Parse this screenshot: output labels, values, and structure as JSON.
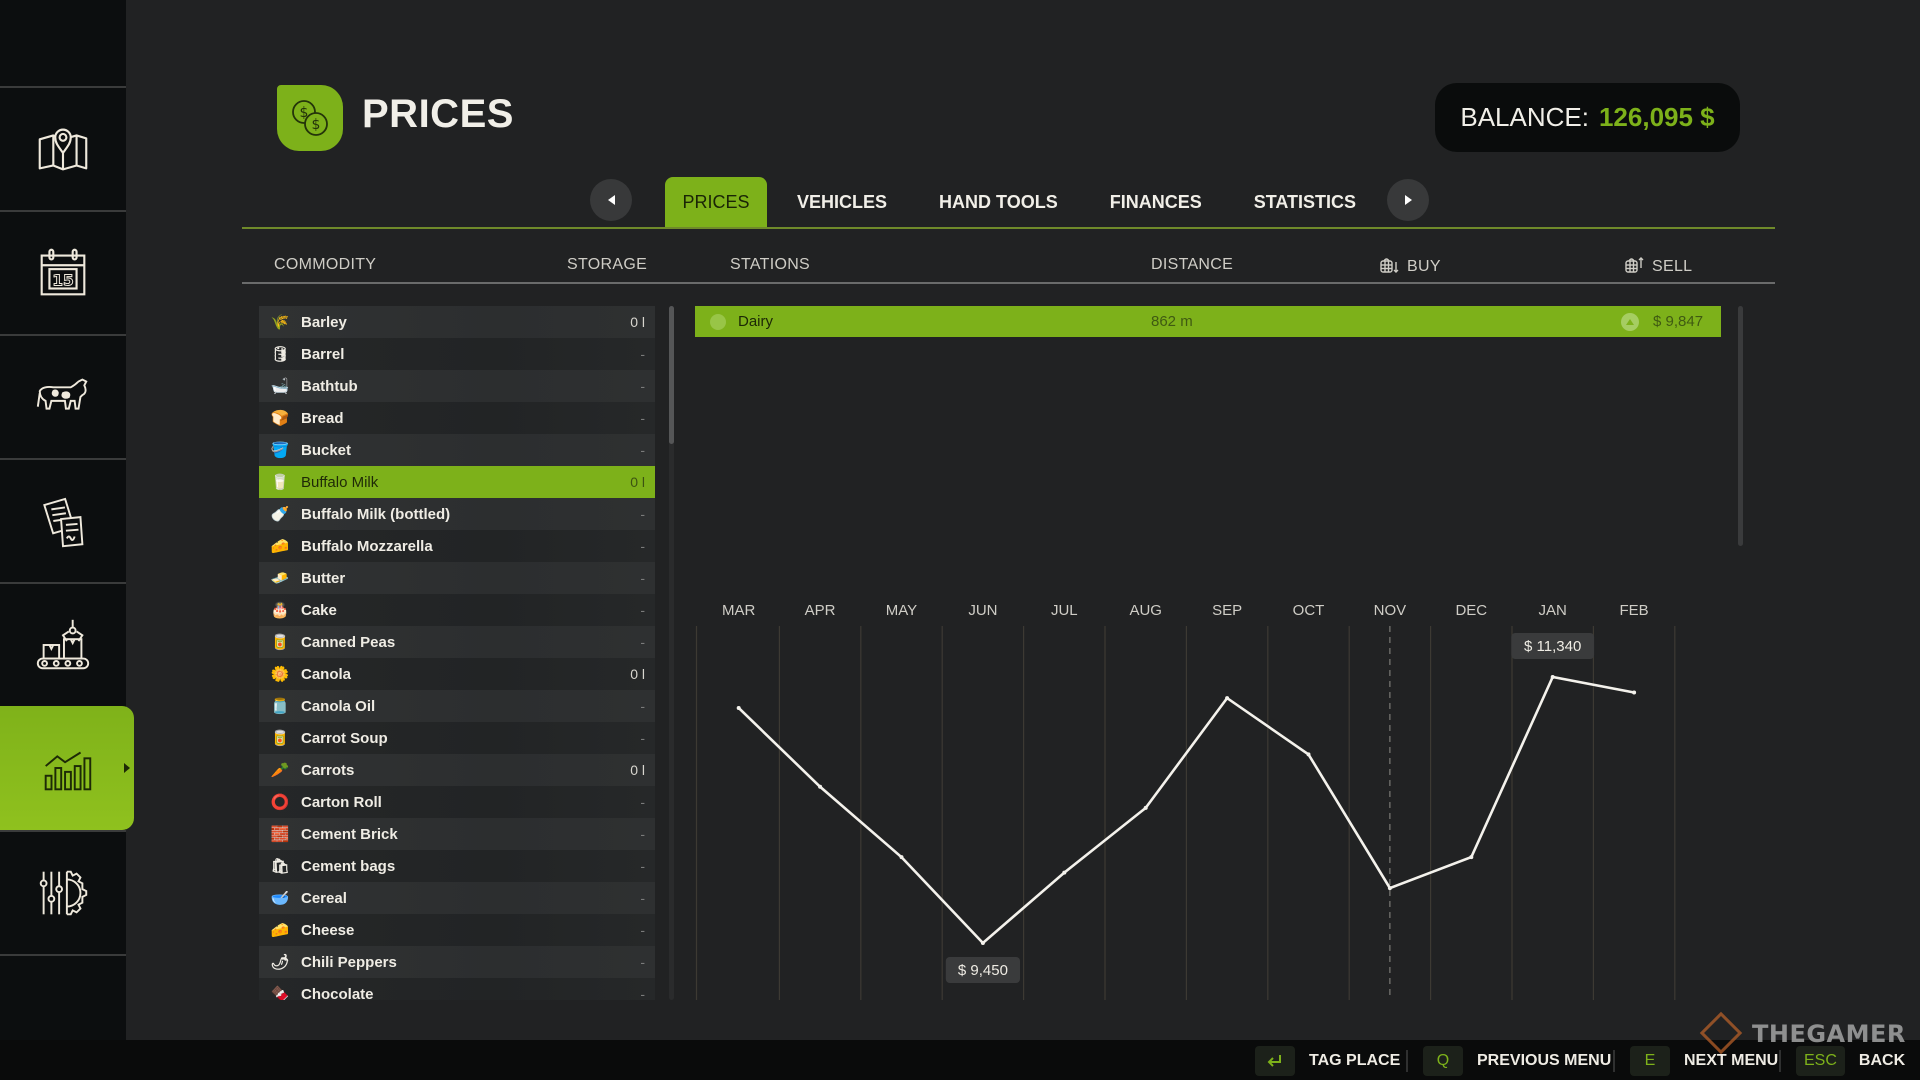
{
  "sidebar": {
    "items": [
      {
        "name": "map",
        "icon": "map-pin-icon",
        "active": false
      },
      {
        "name": "calendar",
        "icon": "calendar-icon",
        "active": false,
        "day": "15"
      },
      {
        "name": "animals",
        "icon": "cow-icon",
        "active": false
      },
      {
        "name": "contracts",
        "icon": "documents-icon",
        "active": false
      },
      {
        "name": "production",
        "icon": "production-icon",
        "active": false
      },
      {
        "name": "prices",
        "icon": "chart-icon",
        "active": true
      },
      {
        "name": "settings",
        "icon": "settings-icon",
        "active": false
      }
    ]
  },
  "header": {
    "title": "PRICES",
    "icon": "coins-icon",
    "balance_label": "BALANCE:",
    "balance_value": "126,095 $"
  },
  "tabs": [
    {
      "label": "PRICES",
      "active": true
    },
    {
      "label": "VEHICLES",
      "active": false
    },
    {
      "label": "HAND TOOLS",
      "active": false
    },
    {
      "label": "FINANCES",
      "active": false
    },
    {
      "label": "STATISTICS",
      "active": false
    }
  ],
  "columns": {
    "commodity": "COMMODITY",
    "storage": "STORAGE",
    "stations": "STATIONS",
    "distance": "DISTANCE",
    "buy": "BUY",
    "sell": "SELL"
  },
  "commodities": [
    {
      "name": "Barley",
      "storage": "0 l",
      "icon": "🌾"
    },
    {
      "name": "Barrel",
      "storage": "-",
      "icon": "🛢"
    },
    {
      "name": "Bathtub",
      "storage": "-",
      "icon": "🛁"
    },
    {
      "name": "Bread",
      "storage": "-",
      "icon": "🍞"
    },
    {
      "name": "Bucket",
      "storage": "-",
      "icon": "🪣"
    },
    {
      "name": "Buffalo Milk",
      "storage": "0 l",
      "icon": "🥛",
      "selected": true
    },
    {
      "name": "Buffalo Milk (bottled)",
      "storage": "-",
      "icon": "🍼"
    },
    {
      "name": "Buffalo Mozzarella",
      "storage": "-",
      "icon": "🧀"
    },
    {
      "name": "Butter",
      "storage": "-",
      "icon": "🧈"
    },
    {
      "name": "Cake",
      "storage": "-",
      "icon": "🎂"
    },
    {
      "name": "Canned Peas",
      "storage": "-",
      "icon": "🥫"
    },
    {
      "name": "Canola",
      "storage": "0 l",
      "icon": "🌼"
    },
    {
      "name": "Canola Oil",
      "storage": "-",
      "icon": "🫙"
    },
    {
      "name": "Carrot Soup",
      "storage": "-",
      "icon": "🥫"
    },
    {
      "name": "Carrots",
      "storage": "0 l",
      "icon": "🥕"
    },
    {
      "name": "Carton Roll",
      "storage": "-",
      "icon": "⭕"
    },
    {
      "name": "Cement Brick",
      "storage": "-",
      "icon": "🧱"
    },
    {
      "name": "Cement bags",
      "storage": "-",
      "icon": "🛍"
    },
    {
      "name": "Cereal",
      "storage": "-",
      "icon": "🥣"
    },
    {
      "name": "Cheese",
      "storage": "-",
      "icon": "🧀"
    },
    {
      "name": "Chili Peppers",
      "storage": "-",
      "icon": "🌶"
    },
    {
      "name": "Chocolate",
      "storage": "-",
      "icon": "🍫"
    }
  ],
  "stations": [
    {
      "name": "Dairy",
      "distance": "862 m",
      "sell_price": "$ 9,847",
      "trend": "up"
    }
  ],
  "chart_data": {
    "type": "line",
    "title": "",
    "categories": [
      "MAR",
      "APR",
      "MAY",
      "JUN",
      "JUL",
      "AUG",
      "SEP",
      "OCT",
      "NOV",
      "DEC",
      "JAN",
      "FEB"
    ],
    "series": [
      {
        "name": "Buffalo Milk - Dairy",
        "values": [
          11120,
          10560,
          10060,
          9450,
          9950,
          10410,
          11190,
          10790,
          9840,
          10060,
          11340,
          11230
        ]
      }
    ],
    "current_month": "NOV",
    "annotations": [
      {
        "category": "JUN",
        "label": "$ 9,450",
        "kind": "min"
      },
      {
        "category": "JAN",
        "label": "$ 11,340",
        "kind": "max"
      }
    ],
    "xlabel": "",
    "ylabel": "",
    "ylim": [
      8600,
      11800
    ],
    "grid": "vertical"
  },
  "footer": {
    "buttons": [
      {
        "key_icon": "enter-icon",
        "key": "⏎",
        "label": "TAG PLACE"
      },
      {
        "key": "Q",
        "label": "PREVIOUS MENU"
      },
      {
        "key": "E",
        "label": "NEXT MENU"
      },
      {
        "key": "ESC",
        "label": "BACK"
      }
    ]
  },
  "watermark": "THEGAMER"
}
